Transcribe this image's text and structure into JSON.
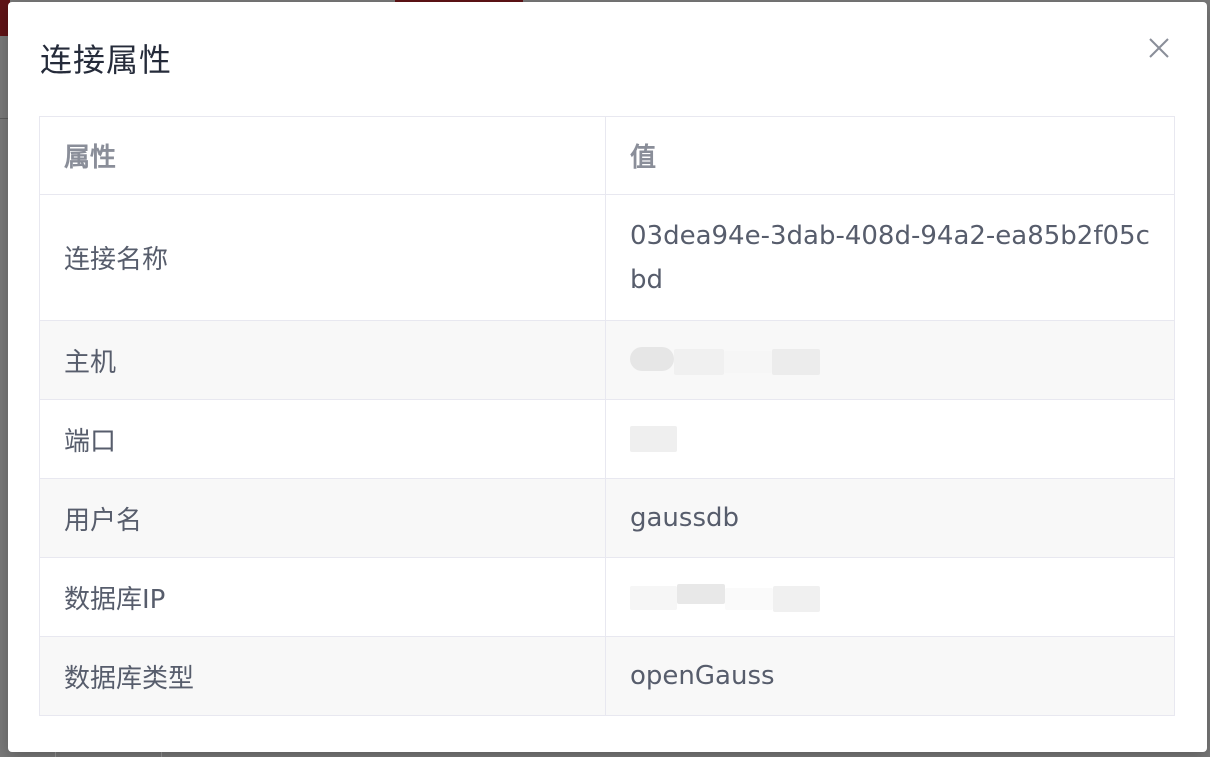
{
  "dialog": {
    "title": "连接属性",
    "close_icon": "close-icon"
  },
  "table": {
    "headers": [
      "属性",
      "值"
    ],
    "rows": [
      {
        "key": "连接名称",
        "value": "03dea94e-3dab-408d-94a2-ea85b2f05cbd"
      },
      {
        "key": "主机",
        "value": ""
      },
      {
        "key": "端口",
        "value": ""
      },
      {
        "key": "用户名",
        "value": "gaussdb"
      },
      {
        "key": "数据库IP",
        "value": ""
      },
      {
        "key": "数据库类型",
        "value": "openGauss"
      }
    ]
  },
  "colors": {
    "title": "#252b3a",
    "header_text": "#8a8e99",
    "cell_text": "#575d6c",
    "border": "#e8e8f0",
    "alt_row": "#f8f8f8",
    "accent_red": "#c0262c"
  }
}
